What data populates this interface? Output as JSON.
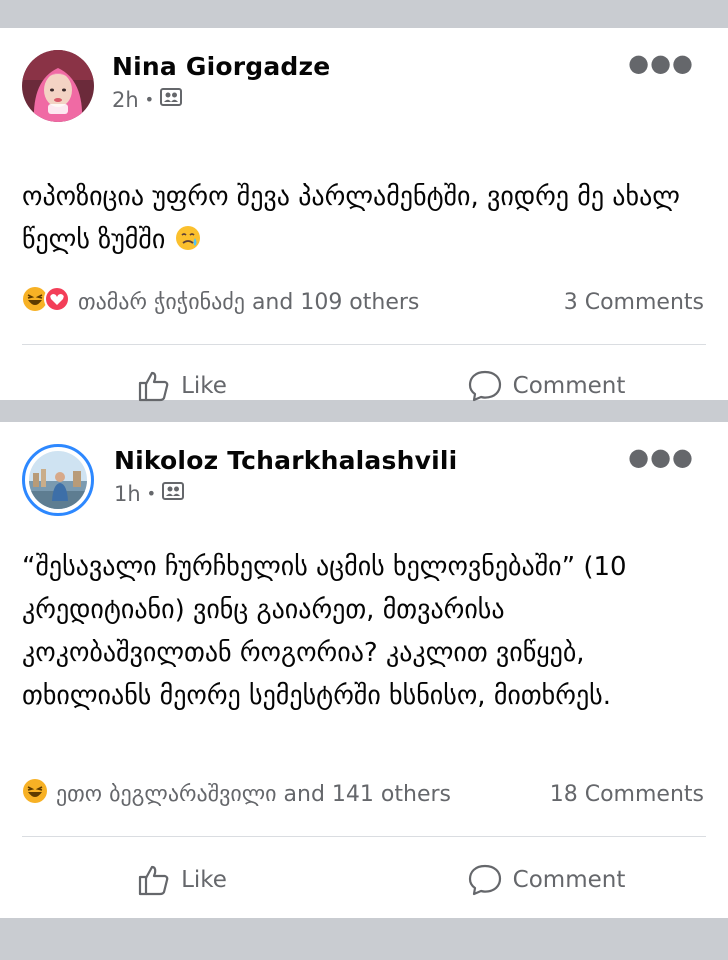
{
  "colors": {
    "separator": "#c9ccd1",
    "muted": "#65676b",
    "accent": "#2d88ff",
    "love": "#f33e58",
    "haha": "#f7b125"
  },
  "posts": [
    {
      "author": "Nina Giorgadze",
      "time": "2h",
      "privacy_icon": "friends-icon",
      "text": "ოპოზიცია უფრო შევა პარლამენტში, ვიდრე მე ახალ წელს ზუმში",
      "text_emoji": "crying-smile-emoji",
      "reactions": [
        "haha-reaction-icon",
        "love-reaction-icon"
      ],
      "reactions_text": "თამარ ჭიჭინაძე and 109 others",
      "comments_text": "3 Comments",
      "like_label": "Like",
      "comment_label": "Comment"
    },
    {
      "author": "Nikoloz Tcharkhalashvili",
      "time": "1h",
      "privacy_icon": "friends-icon",
      "text": "“შესავალი ჩურჩხელის აცმის ხელოვნებაში” (10 კრედიტიანი) ვინც გაიარეთ, მთვარისა კოკობაშვილთან როგორია? კაკლით ვიწყებ, თხილიანს მეორე სემესტრში ხსნისო, მითხრეს.",
      "reactions": [
        "haha-reaction-icon"
      ],
      "reactions_text": "ეთო ბეგლარაშვილი and 141 others",
      "comments_text": "18 Comments",
      "like_label": "Like",
      "comment_label": "Comment"
    }
  ]
}
